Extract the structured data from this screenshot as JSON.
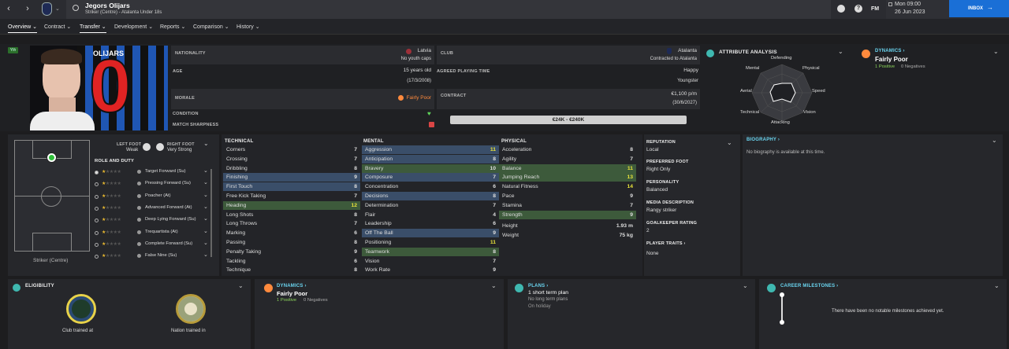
{
  "header": {
    "player_name": "Jegors Olijars",
    "subtitle": "Striker (Centre) - Atalanta Under 18s",
    "date_line1": "Mon 09:00",
    "date_line2": "26 Jun 2023",
    "inbox": "INBOX",
    "fm": "FM"
  },
  "tabs": [
    {
      "label": "Overview"
    },
    {
      "label": "Contract"
    },
    {
      "label": "Transfer"
    },
    {
      "label": "Development"
    },
    {
      "label": "Reports"
    },
    {
      "label": "Comparison"
    },
    {
      "label": "History"
    }
  ],
  "profile": {
    "yth": "Yth",
    "shirt_name": "OLIJARS",
    "shirt_number": "0",
    "nationality_label": "NATIONALITY",
    "nationality": "Latvia",
    "youth_caps": "No youth caps",
    "club_label": "CLUB",
    "club": "Atalanta",
    "club_status": "Contracted to Atalanta",
    "age_label": "AGE",
    "age": "15 years old",
    "dob": "(17/3/2008)",
    "apt_label": "AGREED PLAYING TIME",
    "apt_mood": "Happy",
    "apt_value": "Youngster",
    "morale_label": "MORALE",
    "morale": "Fairly Poor",
    "contract_label": "CONTRACT",
    "wage": "€1,100 p/m",
    "expiry": "(30/6/2027)",
    "condition_label": "CONDITION",
    "sharpness_label": "MATCH SHARPNESS",
    "value_range": "€24K - €240K"
  },
  "attr_analysis": {
    "title": "ATTRIBUTE ANALYSIS",
    "labels": {
      "defending": "Defending",
      "physical": "Physical",
      "speed": "Speed",
      "vision": "Vision",
      "attacking": "Attacking",
      "technical": "Technical",
      "aerial": "Aerial",
      "mental": "Mental"
    }
  },
  "dynamics_top": {
    "title": "DYNAMICS",
    "value": "Fairly Poor",
    "positive": "1 Positive",
    "negative": "0 Negatives"
  },
  "pitch": {
    "position": "Striker (Centre)",
    "left_foot_label": "LEFT FOOT",
    "left_foot": "Weak",
    "right_foot_label": "RIGHT FOOT",
    "right_foot": "Very Strong",
    "roles_title": "ROLE AND DUTY"
  },
  "roles": [
    "Target Forward (Su)",
    "Pressing Forward (Su)",
    "Poacher (At)",
    "Advanced Forward (At)",
    "Deep Lying Forward (Su)",
    "Trequartista (At)",
    "Complete Forward (Su)",
    "False Nine (Su)"
  ],
  "technical": {
    "title": "TECHNICAL",
    "rows": [
      [
        "Corners",
        "7"
      ],
      [
        "Crossing",
        "7"
      ],
      [
        "Dribbling",
        "8"
      ],
      [
        "Finishing",
        "9"
      ],
      [
        "First Touch",
        "8"
      ],
      [
        "Free Kick Taking",
        "7"
      ],
      [
        "Heading",
        "12"
      ],
      [
        "Long Shots",
        "8"
      ],
      [
        "Long Throws",
        "7"
      ],
      [
        "Marking",
        "6"
      ],
      [
        "Passing",
        "8"
      ],
      [
        "Penalty Taking",
        "9"
      ],
      [
        "Tackling",
        "6"
      ],
      [
        "Technique",
        "8"
      ]
    ]
  },
  "mental": {
    "title": "MENTAL",
    "rows": [
      [
        "Aggression",
        "11"
      ],
      [
        "Anticipation",
        "8"
      ],
      [
        "Bravery",
        "10"
      ],
      [
        "Composure",
        "7"
      ],
      [
        "Concentration",
        "6"
      ],
      [
        "Decisions",
        "8"
      ],
      [
        "Determination",
        "7"
      ],
      [
        "Flair",
        "4"
      ],
      [
        "Leadership",
        "6"
      ],
      [
        "Off The Ball",
        "9"
      ],
      [
        "Positioning",
        "11"
      ],
      [
        "Teamwork",
        "8"
      ],
      [
        "Vision",
        "7"
      ],
      [
        "Work Rate",
        "9"
      ]
    ]
  },
  "physical": {
    "title": "PHYSICAL",
    "rows": [
      [
        "Acceleration",
        "8"
      ],
      [
        "Agility",
        "7"
      ],
      [
        "Balance",
        "11"
      ],
      [
        "Jumping Reach",
        "13"
      ],
      [
        "Natural Fitness",
        "14"
      ],
      [
        "Pace",
        "9"
      ],
      [
        "Stamina",
        "7"
      ],
      [
        "Strength",
        "9"
      ]
    ],
    "height_label": "Height",
    "height": "1.93 m",
    "weight_label": "Weight",
    "weight": "75 kg"
  },
  "info": {
    "reputation_label": "REPUTATION",
    "reputation": "Local",
    "pref_foot_label": "PREFERRED FOOT",
    "pref_foot": "Right Only",
    "personality_label": "PERSONALITY",
    "personality": "Balanced",
    "media_label": "MEDIA DESCRIPTION",
    "media": "Rangy striker",
    "gk_label": "GOALKEEPER RATING",
    "gk": "2",
    "traits_label": "PLAYER TRAITS",
    "traits": "None"
  },
  "biography": {
    "title": "BIOGRAPHY",
    "text": "No biography is available at this time."
  },
  "eligibility": {
    "title": "ELIGIBILITY",
    "club_trained": "Club trained at",
    "nation_trained": "Nation trained in"
  },
  "dynamics_bottom": {
    "title": "DYNAMICS",
    "value": "Fairly Poor",
    "positive": "1 Positive",
    "negative": "0 Negatives"
  },
  "plans": {
    "title": "PLANS",
    "short": "1 short term plan",
    "long": "No long term plans",
    "holiday": "On holiday"
  },
  "milestones": {
    "title": "CAREER MILESTONES",
    "text": "There have been no notable milestones achieved yet."
  },
  "colors": {
    "accent": "#6ad5f0",
    "green": "#8bd35a",
    "morale": "#ff8a3d",
    "yellow": "#e8e23a",
    "inbox": "#1a6fd6"
  }
}
